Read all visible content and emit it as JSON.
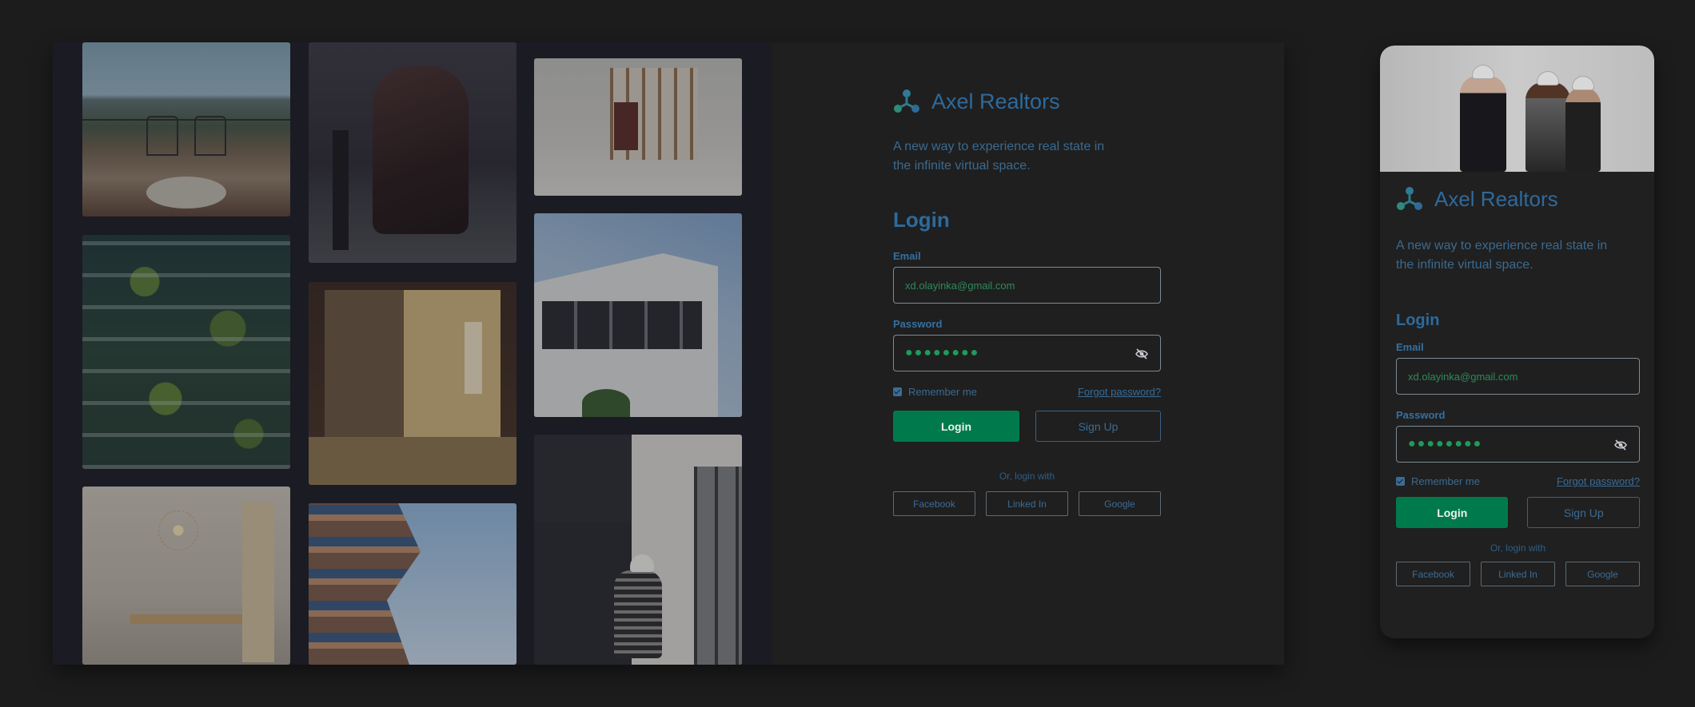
{
  "brand": {
    "name": "Axel Realtors",
    "tagline": "A new way to experience real state in the infinite virtual space.",
    "accent": "#007a4c",
    "brand_color": "#2e6a9c"
  },
  "form": {
    "title": "Login",
    "email_label": "Email",
    "email_value": "xd.olayinka@gmail.com",
    "password_label": "Password",
    "password_mask": "●●●●●●●●",
    "remember_label": "Remember me",
    "forgot_label": "Forgot password?",
    "login_button": "Login",
    "signup_button": "Sign Up",
    "or_label": "Or, login with",
    "social": [
      "Facebook",
      "Linked In",
      "Google"
    ]
  },
  "gallery": {
    "photos": [
      "balcony-sea-view",
      "leather-armchair",
      "white-shelving-room",
      "vertical-forest-building",
      "japanese-interior",
      "modern-white-house",
      "white-dining-room",
      "stacked-apartments",
      "construction-worker"
    ]
  },
  "mobile_hero": "engineers-with-hard-hats",
  "icons": {
    "logo": "tri-node-logo-icon",
    "password_toggle": "eye-off-icon",
    "checkbox": "checkbox-checked-icon"
  }
}
